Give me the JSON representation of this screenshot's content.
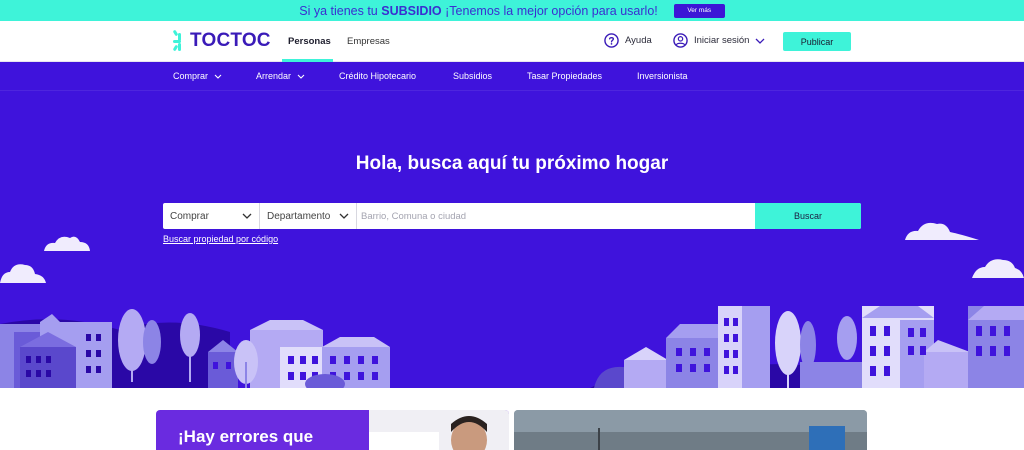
{
  "banner": {
    "text_prefix": "Si ya tienes tu ",
    "text_bold": "SUBSIDIO",
    "text_suffix": " ¡Tenemos la mejor opción para usarlo!",
    "button_label": "Ver más"
  },
  "header": {
    "logo_text": "TOCTOC",
    "tabs": [
      {
        "label": "Personas",
        "active": true
      },
      {
        "label": "Empresas",
        "active": false
      }
    ],
    "help_label": "Ayuda",
    "login_label": "Iniciar sesión",
    "publish_label": "Publicar"
  },
  "subnav": {
    "items": [
      {
        "label": "Comprar",
        "has_dropdown": true
      },
      {
        "label": "Arrendar",
        "has_dropdown": true
      },
      {
        "label": "Crédito Hipotecario",
        "has_dropdown": false
      },
      {
        "label": "Subsidios",
        "has_dropdown": false
      },
      {
        "label": "Tasar Propiedades",
        "has_dropdown": false
      },
      {
        "label": "Inversionista",
        "has_dropdown": false
      }
    ]
  },
  "hero": {
    "title": "Hola, busca aquí tu próximo hogar",
    "operation_select": "Comprar",
    "property_select": "Departamento",
    "search_placeholder": "Barrio, Comuna o ciudad",
    "search_button": "Buscar",
    "code_link": "Buscar propiedad por código"
  },
  "cards": {
    "card1_text": "¡Hay errores que"
  },
  "colors": {
    "brand_purple": "#3f13dc",
    "accent_aqua": "#3ef3d9",
    "logo_purple": "#3a1bb8"
  }
}
